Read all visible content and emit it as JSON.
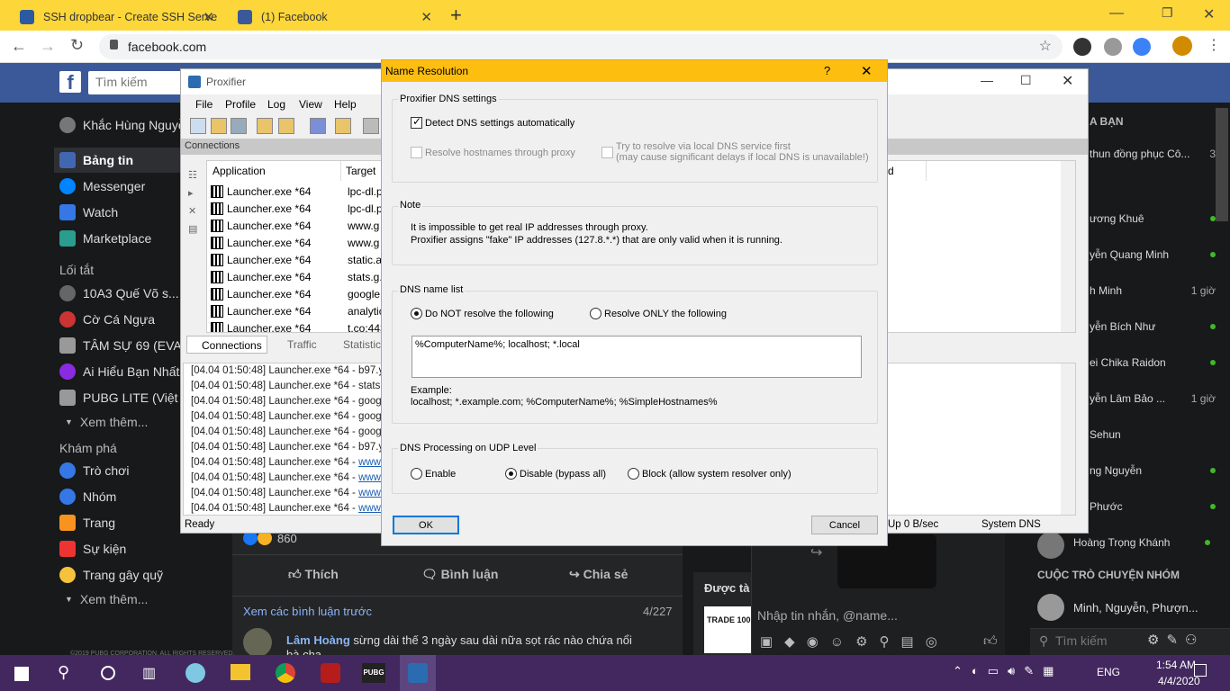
{
  "browser": {
    "tabs": [
      {
        "title": "SSH dropbear - Create SSH Serve",
        "active": false
      },
      {
        "title": "(1) Facebook",
        "active": true
      }
    ],
    "new_tab": "+",
    "url": "facebook.com",
    "window_controls": [
      "—",
      "❐",
      "✕"
    ]
  },
  "facebook": {
    "search_placeholder": "Tìm kiếm",
    "left_nav": [
      {
        "label": "Khắc Hùng Nguyễn",
        "icon": "avatar",
        "color": "#777"
      },
      {
        "label": "Bảng tin",
        "icon": "news-feed-icon",
        "color": "#4267b2"
      },
      {
        "label": "Messenger",
        "icon": "messenger-icon",
        "color": "#0084ff"
      },
      {
        "label": "Watch",
        "icon": "watch-icon",
        "color": "#3578e5"
      },
      {
        "label": "Marketplace",
        "icon": "marketplace-icon",
        "color": "#2a9d8f"
      }
    ],
    "shortcuts_title": "Lối tắt",
    "shortcuts": [
      {
        "label": "10A3 Quế Võ s...",
        "color": "#666"
      },
      {
        "label": "Cờ Cá Ngựa",
        "color": "#c33"
      },
      {
        "label": "TÂM SỰ 69 (EVA -",
        "color": "#999"
      },
      {
        "label": "Ai Hiểu Bạn Nhất",
        "color": "#8a2be2"
      },
      {
        "label": "PUBG LITE (Việt N",
        "color": "#999"
      }
    ],
    "see_more": "Xem thêm...",
    "explore_title": "Khám phá",
    "explore": [
      {
        "label": "Trò chơi",
        "color": "#3578e5"
      },
      {
        "label": "Nhóm",
        "color": "#3578e5"
      },
      {
        "label": "Trang",
        "color": "#f7931e"
      },
      {
        "label": "Sự kiện",
        "color": "#e33"
      },
      {
        "label": "Trang gây quỹ",
        "color": "#f5c33b"
      }
    ],
    "see_more2": "Xem thêm...",
    "post": {
      "reactions": "860",
      "like": "Thích",
      "comment": "Bình luận",
      "share": "Chia sẻ",
      "view_prev": "Xem các bình luận trước",
      "count": "4/227",
      "commenter": "Lâm Hoàng",
      "comment_text": "sừng dài thế 3 ngày sau dài nữa sọt rác nào chứa nổi",
      "comment_text2": "bà cha",
      "copyright": "©2019 PUBG CORPORATION. ALL RIGHTS RESERVED."
    },
    "sponsored_label": "Được tà",
    "trade_text": "TRADE 100",
    "message_placeholder": "Nhập tin nhắn, @name...",
    "right_header": "A BẠN",
    "contacts": [
      {
        "name": "thun đồng phục Cô...",
        "meta": "3"
      },
      {
        "name": "ương Khuê",
        "meta": "dot"
      },
      {
        "name": "yễn Quang Minh",
        "meta": "dot"
      },
      {
        "name": "h Minh",
        "meta": "1 giờ"
      },
      {
        "name": "yễn Bích Như",
        "meta": "dot"
      },
      {
        "name": "ei Chika Raidon",
        "meta": "dot"
      },
      {
        "name": "yễn Lâm Bảo ...",
        "meta": "1 giờ"
      },
      {
        "name": "Sehun",
        "meta": ""
      },
      {
        "name": "ng Nguyễn",
        "meta": "dot"
      },
      {
        "name": "Phước",
        "meta": "dot"
      },
      {
        "name": "Hoàng Trọng Khánh",
        "meta": "dot"
      }
    ],
    "group_chat_title": "CUỘC TRÒ CHUYỆN NHÓM",
    "group_chat": "Minh, Nguyễn, Phượn...",
    "right_search": "Tìm kiếm"
  },
  "proxifier": {
    "title": "Proxifier",
    "menu": [
      "File",
      "Profile",
      "Log",
      "View",
      "Help"
    ],
    "connections_label": "Connections",
    "columns": [
      "Application",
      "Target"
    ],
    "col3_frag": "d",
    "rows": [
      {
        "app": "Launcher.exe *64",
        "target": "lpc-dl.p"
      },
      {
        "app": "Launcher.exe *64",
        "target": "lpc-dl.p"
      },
      {
        "app": "Launcher.exe *64",
        "target": "www.g"
      },
      {
        "app": "Launcher.exe *64",
        "target": "www.g"
      },
      {
        "app": "Launcher.exe *64",
        "target": "static.a"
      },
      {
        "app": "Launcher.exe *64",
        "target": "stats.g."
      },
      {
        "app": "Launcher.exe *64",
        "target": "google"
      },
      {
        "app": "Launcher.exe *64",
        "target": "analytic"
      },
      {
        "app": "Launcher.exe *64",
        "target": "t.co:443"
      }
    ],
    "bottom_tabs": [
      "Connections",
      "Traffic",
      "Statistics"
    ],
    "log": [
      {
        "text": "[04.04 01:50:48] Launcher.exe *64 - b97.yah",
        "link": ""
      },
      {
        "text": "[04.04 01:50:48] Launcher.exe *64 - stats.g.d",
        "link": ""
      },
      {
        "text": "[04.04 01:50:48] Launcher.exe *64 - googlea",
        "link": ""
      },
      {
        "text": "[04.04 01:50:48] Launcher.exe *64 - googlea",
        "link": ""
      },
      {
        "text": "[04.04 01:50:48] Launcher.exe *64 - googlea",
        "link": ""
      },
      {
        "text": "[04.04 01:50:48] Launcher.exe *64 - b97.yah",
        "link": ""
      },
      {
        "text": "[04.04 01:50:48] Launcher.exe *64 - ",
        "link": "www.fac"
      },
      {
        "text": "[04.04 01:50:48] Launcher.exe *64 - ",
        "link": "www.fac"
      },
      {
        "text": "[04.04 01:50:48] Launcher.exe *64 - ",
        "link": "www.go"
      },
      {
        "text": "[04.04 01:50:48] Launcher.exe *64 - ",
        "link": "www.go"
      }
    ],
    "status_ready": "Ready",
    "status_up": "Up 0 B/sec",
    "status_dns": "System DNS"
  },
  "dialog": {
    "title": "Name Resolution",
    "help": "?",
    "close": "✕",
    "dns_settings_group": "Proxifier DNS settings",
    "detect_auto": "Detect DNS settings automatically",
    "detect_auto_checked": true,
    "resolve_through_proxy": "Resolve hostnames through proxy",
    "try_local_1": "Try to resolve via local DNS service first",
    "try_local_2": "(may cause significant delays if local DNS is unavailable!)",
    "note_group": "Note",
    "note_1": "It is impossible to get real IP addresses through proxy.",
    "note_2": "Proxifier assigns \"fake\" IP addresses (127.8.*.*) that are only valid when it is running.",
    "dns_list_group": "DNS name list",
    "do_not_resolve": "Do NOT resolve the following",
    "resolve_only": "Resolve ONLY the following",
    "list_value": "%ComputerName%; localhost; *.local",
    "example_label": "Example:",
    "example_text": "localhost; *.example.com; %ComputerName%; %SimpleHostnames%",
    "udp_group": "DNS Processing on UDP Level",
    "udp_enable": "Enable",
    "udp_disable": "Disable (bypass all)",
    "udp_block": "Block (allow system resolver only)",
    "ok": "OK",
    "cancel": "Cancel"
  },
  "taskbar": {
    "time": "1:54 AM",
    "date": "4/4/2020",
    "lang": "ENG"
  }
}
